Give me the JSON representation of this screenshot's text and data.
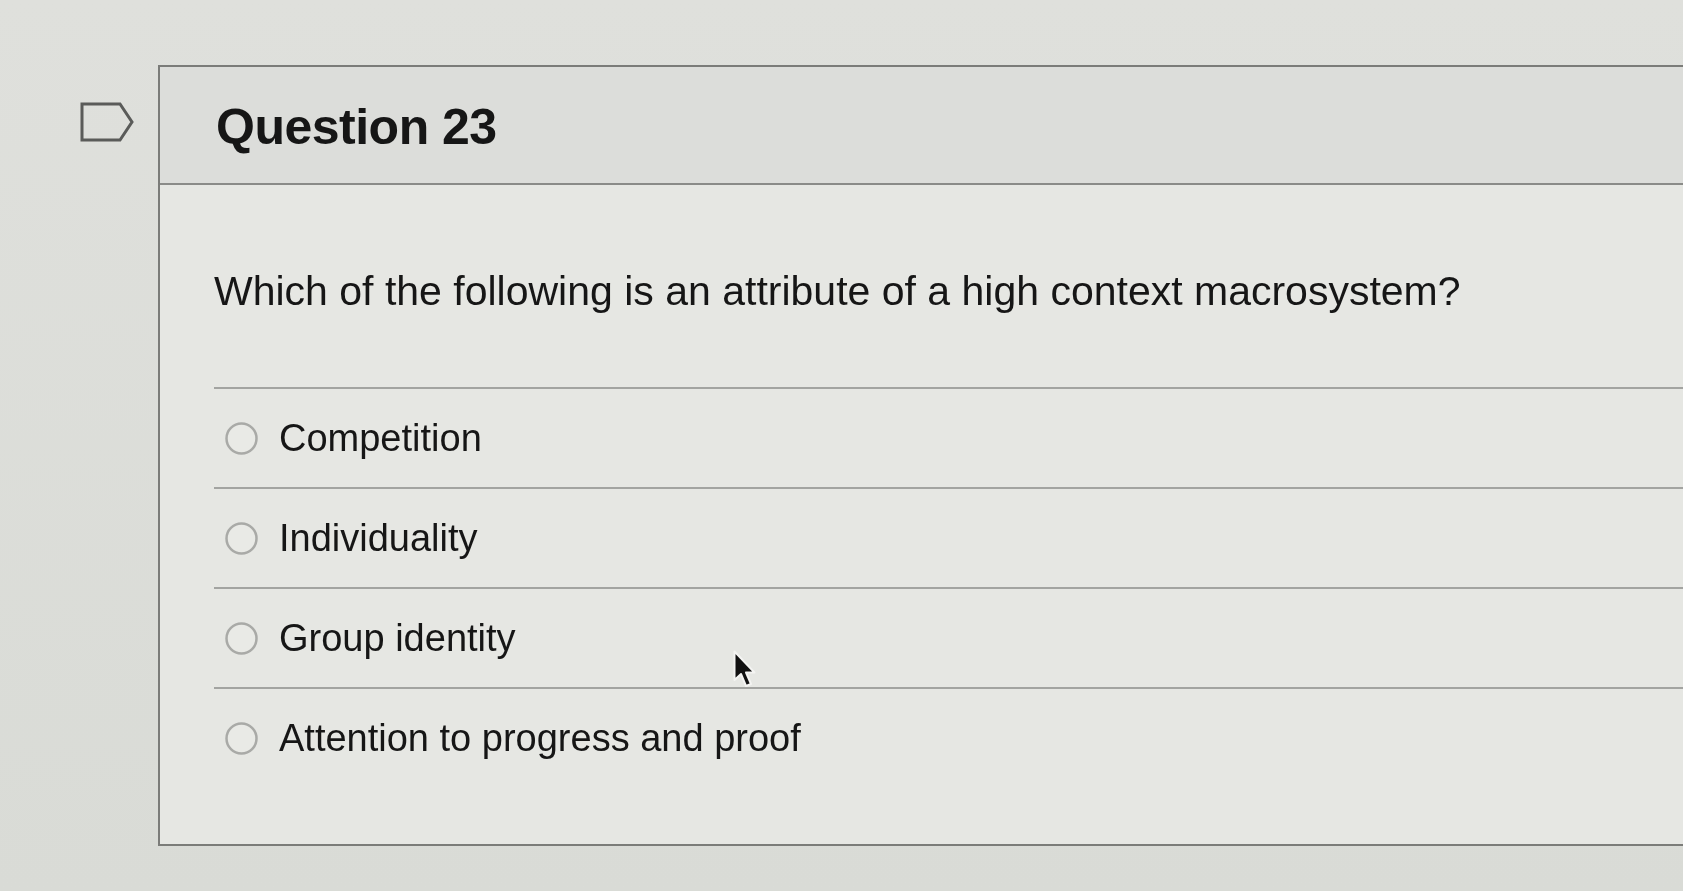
{
  "question": {
    "flagged": false,
    "title": "Question 23",
    "prompt": "Which of the following is an attribute of a high context macrosystem?",
    "options": [
      {
        "label": "Competition",
        "selected": false
      },
      {
        "label": "Individuality",
        "selected": false
      },
      {
        "label": "Group identity",
        "selected": false
      },
      {
        "label": "Attention to progress and proof",
        "selected": false
      }
    ]
  }
}
